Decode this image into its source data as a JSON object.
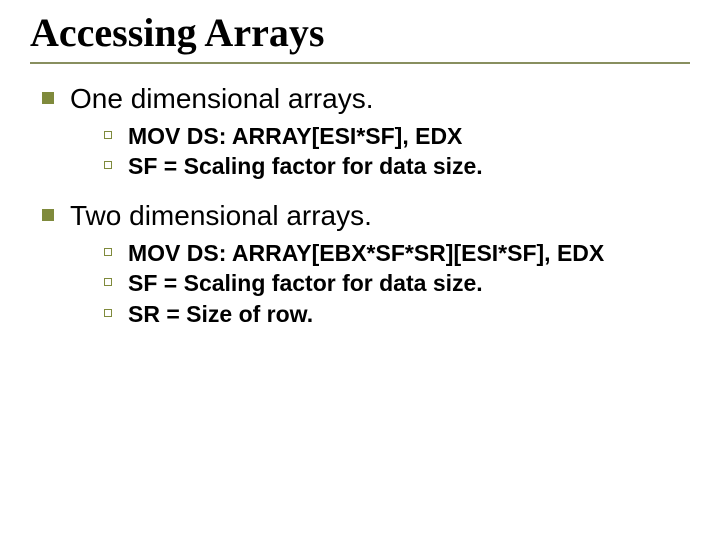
{
  "title": "Accessing Arrays",
  "sections": [
    {
      "heading": "One dimensional arrays.",
      "items": [
        "MOV DS: ARRAY[ESI*SF], EDX",
        "SF = Scaling factor for data size."
      ]
    },
    {
      "heading": "Two dimensional arrays.",
      "items": [
        "MOV DS: ARRAY[EBX*SF*SR][ESI*SF], EDX",
        "SF = Scaling factor for data size.",
        "SR = Size of row."
      ]
    }
  ]
}
